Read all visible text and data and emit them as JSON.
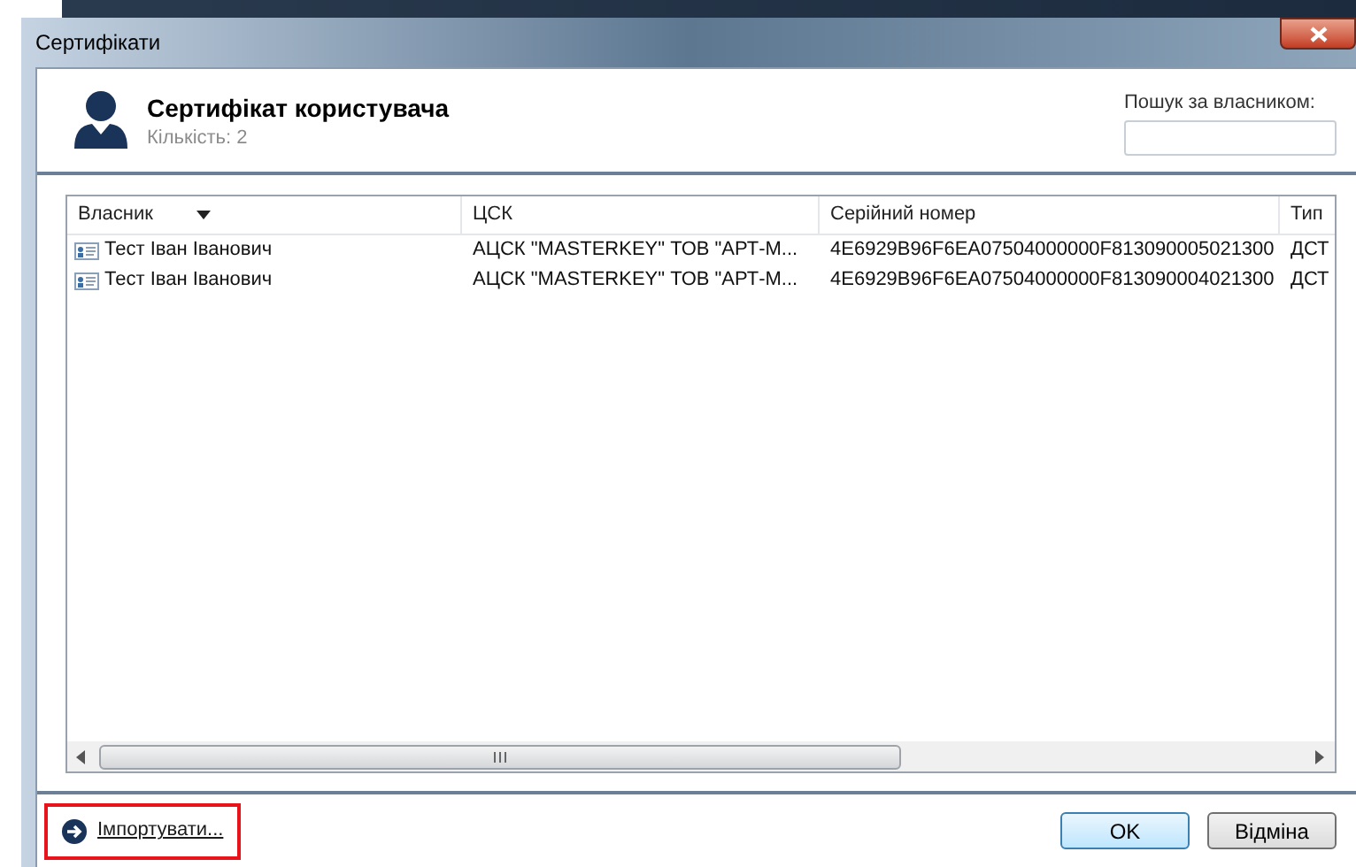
{
  "window": {
    "title": "Сертифікати"
  },
  "header": {
    "title": "Сертифікат користувача",
    "count": "Кількість: 2"
  },
  "search": {
    "label": "Пошук за власником:"
  },
  "table": {
    "columns": [
      {
        "label": "Власник",
        "sorted": true
      },
      {
        "label": "ЦСК",
        "sorted": false
      },
      {
        "label": "Серійний номер",
        "sorted": false
      },
      {
        "label": "Тип",
        "sorted": false
      }
    ],
    "rows": [
      {
        "cells": [
          "Тест Іван Іванович",
          "АЦСК \"MASTERKEY\" ТОВ \"АРТ-М...",
          "4E6929B96F6EA07504000000F813090005021300",
          "ДСТ"
        ]
      },
      {
        "cells": [
          "Тест Іван Іванович",
          "АЦСК \"MASTERKEY\" ТОВ \"АРТ-М...",
          "4E6929B96F6EA07504000000F813090004021300",
          "ДСТ"
        ]
      }
    ]
  },
  "import_link": {
    "label": "Імпортувати...",
    "highlighted": true
  },
  "buttons": [
    {
      "label": "OK",
      "default": true
    },
    {
      "label": "Відміна",
      "default": false
    }
  ]
}
